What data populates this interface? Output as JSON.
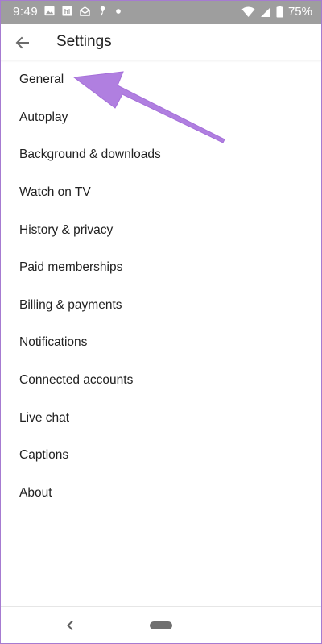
{
  "status_bar": {
    "time": "9:49",
    "battery": "75%",
    "left_icons": [
      "image-icon",
      "hike-icon",
      "mail-icon",
      "gps-icon",
      "dot-icon"
    ],
    "right_icons": [
      "wifi-icon",
      "signal-icon",
      "battery-icon"
    ],
    "background": "#9e9e9e"
  },
  "app_bar": {
    "title": "Settings",
    "back_icon": "arrow-back-icon"
  },
  "settings": {
    "items": [
      {
        "label": "General"
      },
      {
        "label": "Autoplay"
      },
      {
        "label": "Background & downloads"
      },
      {
        "label": "Watch on TV"
      },
      {
        "label": "History & privacy"
      },
      {
        "label": "Paid memberships"
      },
      {
        "label": "Billing & payments"
      },
      {
        "label": "Notifications"
      },
      {
        "label": "Connected accounts"
      },
      {
        "label": "Live chat"
      },
      {
        "label": "Captions"
      },
      {
        "label": "About"
      }
    ]
  },
  "annotation": {
    "color": "#b07fe0",
    "points_to": "General"
  },
  "nav_bar": {
    "back_icon": "chevron-left-icon",
    "home_icon": "home-pill-icon"
  }
}
